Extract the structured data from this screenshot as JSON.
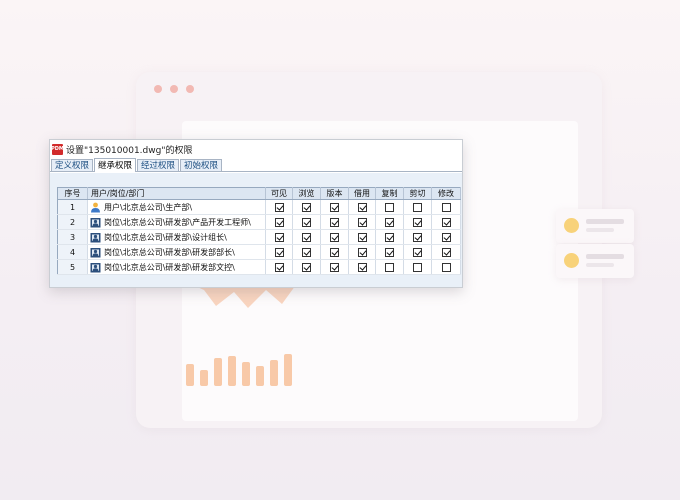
{
  "window": {
    "app_icon_text": "PDM",
    "title": "设置\"135010001.dwg\"的权限"
  },
  "tabs": [
    {
      "label": "定义权限",
      "active": false
    },
    {
      "label": "继承权限",
      "active": true
    },
    {
      "label": "经过权限",
      "active": false
    },
    {
      "label": "初始权限",
      "active": false
    }
  ],
  "table": {
    "headers": [
      "序号",
      "用户/岗位/部门",
      "可见",
      "浏览",
      "版本",
      "借用",
      "复制",
      "剪切",
      "修改"
    ],
    "rows": [
      {
        "index": "1",
        "type": "user",
        "path": "用户\\北京总公司\\生产部\\",
        "perms": [
          true,
          true,
          true,
          true,
          false,
          false,
          false
        ]
      },
      {
        "index": "2",
        "type": "position",
        "path": "岗位\\北京总公司\\研发部\\产品开发工程师\\",
        "perms": [
          true,
          true,
          true,
          true,
          true,
          true,
          true
        ]
      },
      {
        "index": "3",
        "type": "position",
        "path": "岗位\\北京总公司\\研发部\\设计组长\\",
        "perms": [
          true,
          true,
          true,
          true,
          true,
          true,
          true
        ]
      },
      {
        "index": "4",
        "type": "position",
        "path": "岗位\\北京总公司\\研发部\\研发部部长\\",
        "perms": [
          true,
          true,
          true,
          true,
          true,
          true,
          true
        ]
      },
      {
        "index": "5",
        "type": "position",
        "path": "岗位\\北京总公司\\研发部\\研发部文控\\",
        "perms": [
          true,
          true,
          true,
          true,
          false,
          false,
          false
        ]
      }
    ]
  },
  "colors": {
    "accent": "#1a4d80",
    "header_bg": "#dce6f2",
    "content_bg": "#e9f0f8",
    "illustration_orange": "#f8c9a8",
    "illustration_yellow": "#f8d27a"
  },
  "icons": {
    "user": "user-icon",
    "position": "position-icon"
  }
}
